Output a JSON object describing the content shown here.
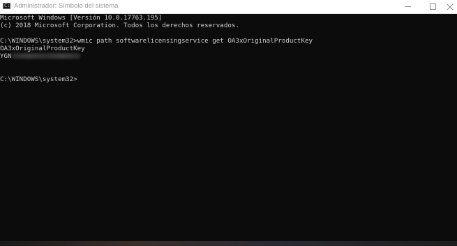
{
  "window": {
    "title": "Administrador: Símbolo del sistema",
    "icon": "cmd-icon",
    "controls": {
      "minimize": "minimize-icon",
      "maximize": "maximize-icon",
      "close": "close-icon"
    }
  },
  "console": {
    "lines": [
      "Microsoft Windows [Versión 10.0.17763.195]",
      "(c) 2018 Microsoft Corporation. Todos los derechos reservados.",
      "",
      "C:\\WINDOWS\\system32>wmic path softwarelicensingservice get OA3xOriginalProductKey",
      "OA3xOriginalProductKey",
      "YGN",
      "",
      "",
      "C:\\WINDOWS\\system32>"
    ]
  },
  "colors": {
    "console_bg": "#0c0c0c",
    "console_text": "#cccccc",
    "titlebar_bg": "#ffffff",
    "title_text": "#9a9a9a"
  }
}
